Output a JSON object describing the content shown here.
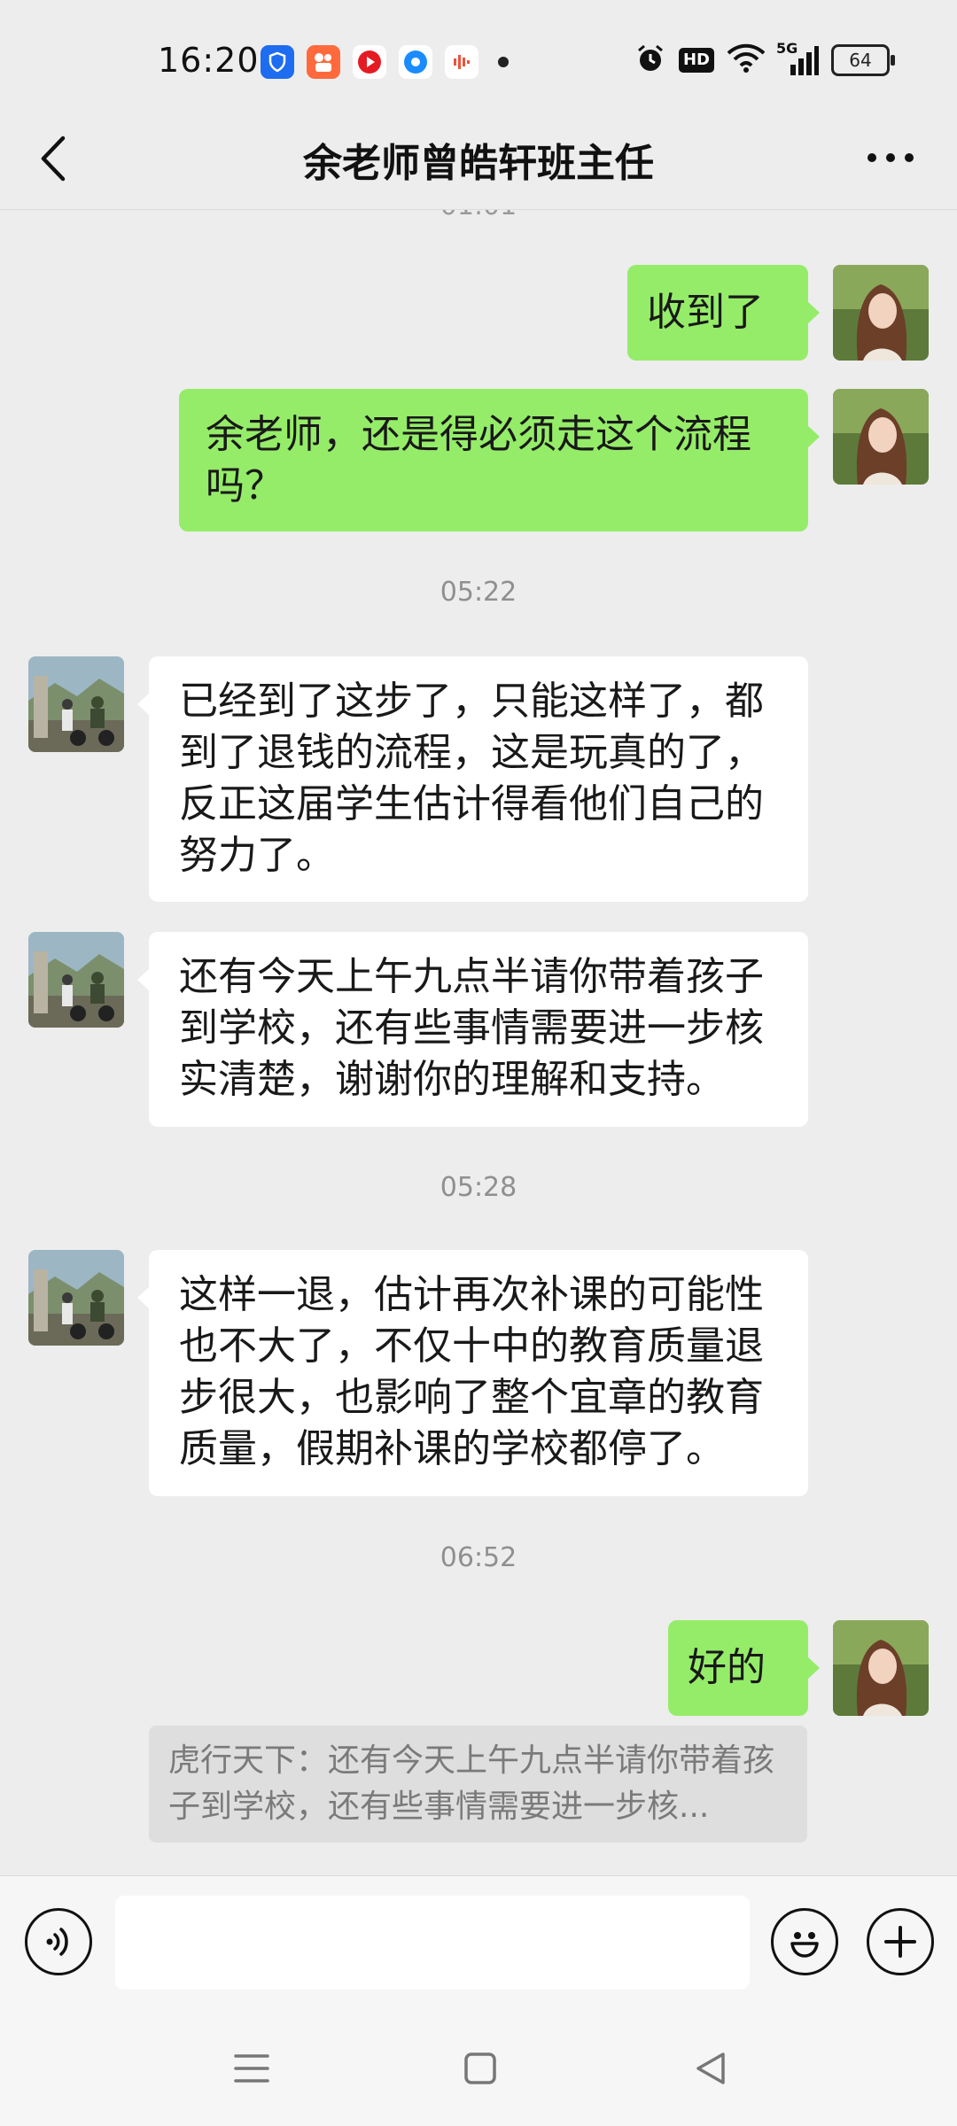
{
  "status_bar": {
    "time": "16:20",
    "network": "5G",
    "hd": "HD",
    "battery": "64",
    "icons": [
      "shield-app-icon",
      "kuaishou-icon",
      "video-app-icon",
      "browser-icon",
      "audio-app-icon"
    ]
  },
  "header": {
    "title": "余老师曾皓轩班主任",
    "back_icon": "chevron-left-icon",
    "more_icon": "more-dots-icon"
  },
  "messages": {
    "clipped_timestamp": "01:01",
    "m1": "收到了",
    "m2": "余老师，还是得必须走这个流程吗？",
    "ts1": "05:22",
    "m3": "已经到了这步了，只能这样了，都到了退钱的流程，这是玩真的了，反正这届学生估计得看他们自己的努力了。",
    "m4": "还有今天上午九点半请你带着孩子到学校，还有些事情需要进一步核实清楚，谢谢你的理解和支持。",
    "ts2": "05:28",
    "m5": "这样一退，估计再次补课的可能性也不大了，不仅十中的教育质量退步很大，也影响了整个宜章的教育质量，假期补课的学校都停了。",
    "ts3": "06:52",
    "m6": "好的",
    "quote": "虎行天下：还有今天上午九点半请你带着孩子到学校，还有些事情需要进一步核..."
  },
  "colors": {
    "background": "#ededed",
    "outgoing_bubble": "#95ec69",
    "incoming_bubble": "#ffffff"
  },
  "input_bar": {
    "voice_icon": "voice-icon",
    "emoji_icon": "emoji-icon",
    "plus_icon": "plus-icon"
  },
  "nav_bar": {
    "icons": [
      "menu-icon",
      "home-icon",
      "back-triangle-icon"
    ]
  }
}
